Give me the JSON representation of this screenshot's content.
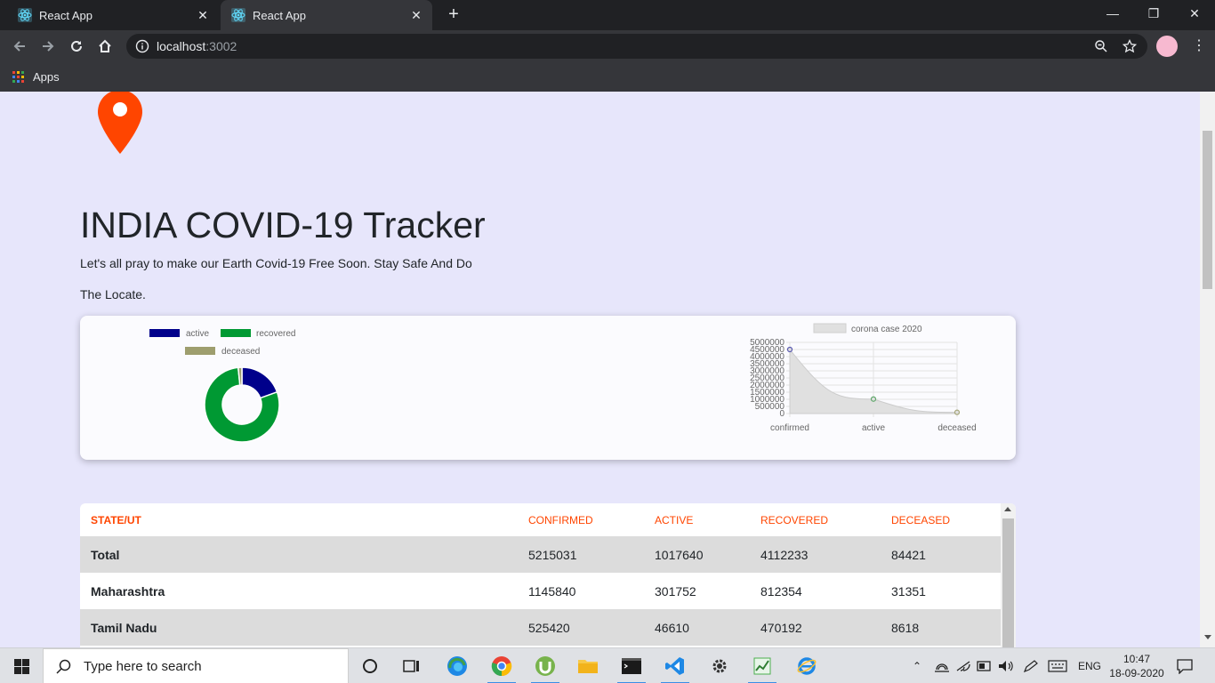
{
  "browser": {
    "tabs": [
      {
        "title": "React App"
      },
      {
        "title": "React App"
      }
    ],
    "url_host": "localhost",
    "url_port": ":3002",
    "bookmarks": {
      "apps_label": "Apps"
    }
  },
  "page": {
    "title": "INDIA COVID-19 Tracker",
    "subtitle_line1": "Let's all pray to make our Earth Covid-19 Free Soon. Stay Safe And Do",
    "subtitle_line2": "The Locate."
  },
  "chart_data": [
    {
      "type": "pie",
      "variant": "doughnut",
      "legend": [
        "active",
        "recovered",
        "deceased"
      ],
      "colors": [
        "#00008b",
        "#009933",
        "#9e9e6e"
      ],
      "values": [
        1017640,
        4112233,
        84421
      ],
      "legend_placement": "top"
    },
    {
      "type": "area",
      "legend": [
        "corona case 2020"
      ],
      "categories": [
        "confirmed",
        "active",
        "deceased"
      ],
      "values": [
        4500000,
        1017640,
        84421
      ],
      "ylim": [
        0,
        5000000
      ],
      "y_ticks": [
        "5000000",
        "4500000",
        "4000000",
        "3500000",
        "3000000",
        "2500000",
        "2000000",
        "1500000",
        "1000000",
        "500000",
        "0"
      ],
      "grid": true,
      "legend_placement": "top"
    }
  ],
  "table": {
    "headers": [
      "STATE/UT",
      "CONFIRMED",
      "ACTIVE",
      "RECOVERED",
      "DECEASED"
    ],
    "rows": [
      [
        "Total",
        "5215031",
        "1017640",
        "4112233",
        "84421"
      ],
      [
        "Maharashtra",
        "1145840",
        "301752",
        "812354",
        "31351"
      ],
      [
        "Tamil Nadu",
        "525420",
        "46610",
        "470192",
        "8618"
      ]
    ]
  },
  "taskbar": {
    "search_placeholder": "Type here to search",
    "language": "ENG",
    "time": "10:47",
    "date": "18-09-2020"
  }
}
